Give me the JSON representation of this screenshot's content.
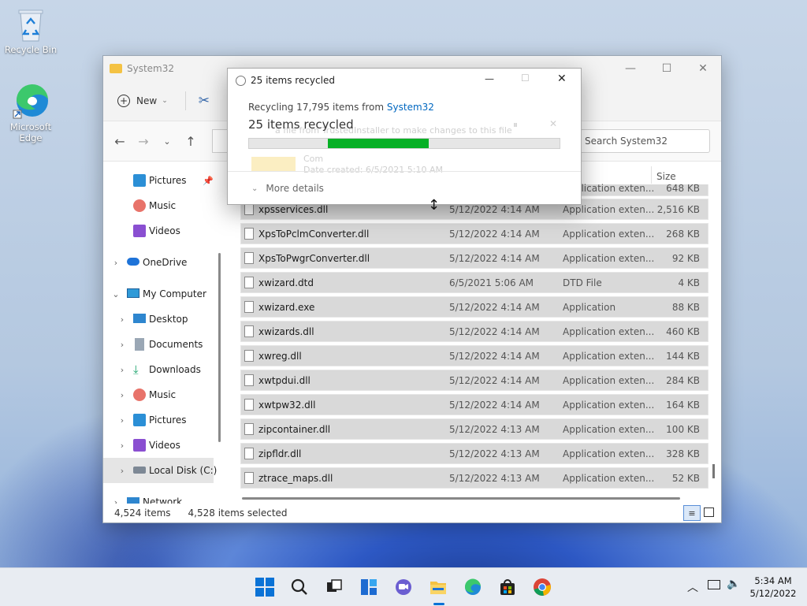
{
  "desktop": {
    "icons": [
      {
        "label": "Recycle Bin",
        "icon": "recycle-bin-icon"
      },
      {
        "label": "Microsoft Edge",
        "icon": "edge-icon"
      }
    ]
  },
  "explorer": {
    "title": "System32",
    "toolbar": {
      "new_label": "New"
    },
    "search_placeholder": "Search System32",
    "sidebar": [
      {
        "label": "Pictures",
        "icon": "pictures-icon",
        "pinned": true
      },
      {
        "label": "Music",
        "icon": "music-icon"
      },
      {
        "label": "Videos",
        "icon": "videos-icon"
      },
      {
        "label": "OneDrive",
        "icon": "onedrive-icon"
      },
      {
        "label": "My Computer",
        "icon": "computer-icon"
      },
      {
        "label": "Desktop",
        "icon": "desktop-icon"
      },
      {
        "label": "Documents",
        "icon": "documents-icon"
      },
      {
        "label": "Downloads",
        "icon": "downloads-icon"
      },
      {
        "label": "Music",
        "icon": "music-icon"
      },
      {
        "label": "Pictures",
        "icon": "pictures-icon"
      },
      {
        "label": "Videos",
        "icon": "videos-icon"
      },
      {
        "label": "Local Disk (C:)",
        "icon": "drive-icon",
        "selected": true
      },
      {
        "label": "Network",
        "icon": "network-icon"
      }
    ],
    "columns": {
      "size": "Size"
    },
    "partial_row": {
      "type": "Application exten...",
      "size": "648 KB"
    },
    "files": [
      {
        "name": "xpsservices.dll",
        "date": "5/12/2022 4:14 AM",
        "type": "Application exten...",
        "size": "2,516 KB"
      },
      {
        "name": "XpsToPclmConverter.dll",
        "date": "5/12/2022 4:14 AM",
        "type": "Application exten...",
        "size": "268 KB"
      },
      {
        "name": "XpsToPwgrConverter.dll",
        "date": "5/12/2022 4:14 AM",
        "type": "Application exten...",
        "size": "92 KB"
      },
      {
        "name": "xwizard.dtd",
        "date": "6/5/2021 5:06 AM",
        "type": "DTD File",
        "size": "4 KB"
      },
      {
        "name": "xwizard.exe",
        "date": "5/12/2022 4:14 AM",
        "type": "Application",
        "size": "88 KB"
      },
      {
        "name": "xwizards.dll",
        "date": "5/12/2022 4:14 AM",
        "type": "Application exten...",
        "size": "460 KB"
      },
      {
        "name": "xwreg.dll",
        "date": "5/12/2022 4:14 AM",
        "type": "Application exten...",
        "size": "144 KB"
      },
      {
        "name": "xwtpdui.dll",
        "date": "5/12/2022 4:14 AM",
        "type": "Application exten...",
        "size": "284 KB"
      },
      {
        "name": "xwtpw32.dll",
        "date": "5/12/2022 4:14 AM",
        "type": "Application exten...",
        "size": "164 KB"
      },
      {
        "name": "zipcontainer.dll",
        "date": "5/12/2022 4:13 AM",
        "type": "Application exten...",
        "size": "100 KB"
      },
      {
        "name": "zipfldr.dll",
        "date": "5/12/2022 4:13 AM",
        "type": "Application exten...",
        "size": "328 KB"
      },
      {
        "name": "ztrace_maps.dll",
        "date": "5/12/2022 4:13 AM",
        "type": "Application exten...",
        "size": "52 KB"
      }
    ],
    "status": {
      "items": "4,524 items",
      "selected": "4,528 items selected"
    }
  },
  "dialog": {
    "title": "25 items recycled",
    "line1_prefix": "Recycling 17,795 items from ",
    "line1_link": "System32",
    "heading": "25 items recycled",
    "progress": 0.33,
    "more_details": "More details",
    "ghost_text": "a file from TrustedInstaller to make changes to this file",
    "ghost_name": "Com",
    "ghost_date": "Date created: 6/5/2021 5:10 AM"
  },
  "taskbar": {
    "time": "5:34 AM",
    "date": "5/12/2022"
  },
  "colors": {
    "accent": "#0067c0",
    "progress": "#06b025",
    "link": "#0067c0"
  }
}
